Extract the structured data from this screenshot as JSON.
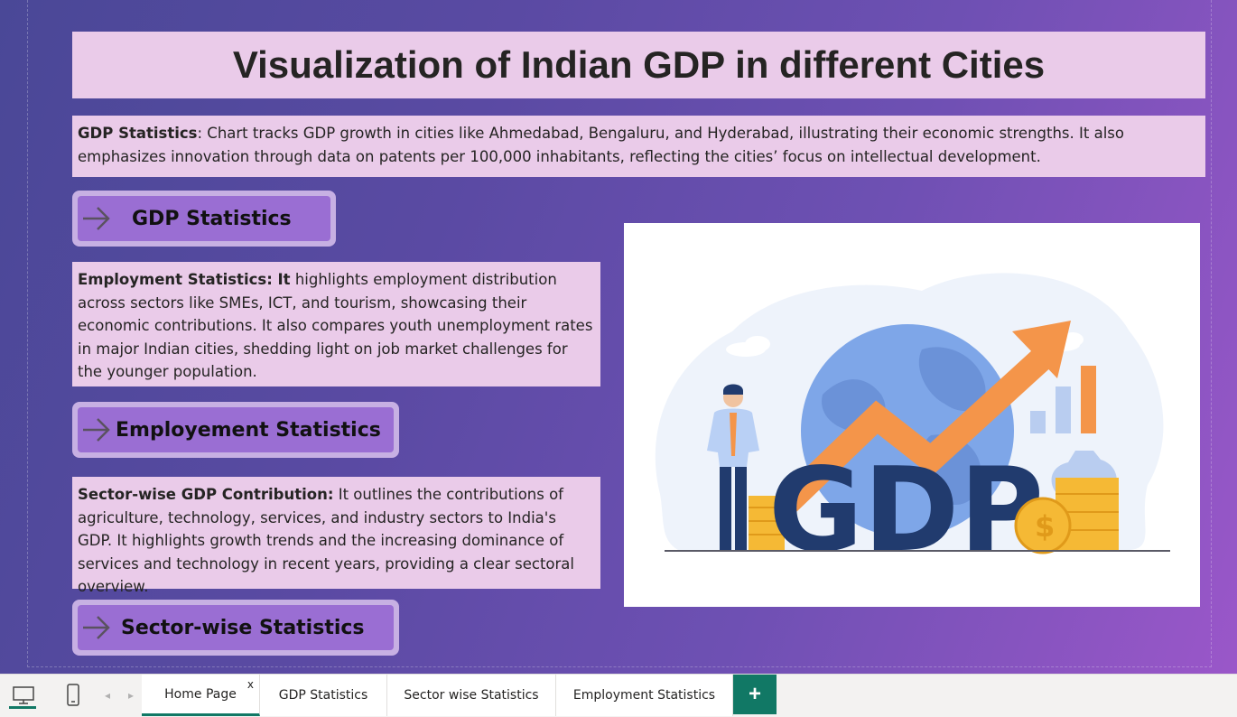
{
  "title": "Visualization of Indian GDP in different Cities",
  "gdp_text": {
    "heading": "GDP Statistics",
    "body": ": Chart tracks GDP growth in cities like Ahmedabad, Bengaluru, and Hyderabad, illustrating their economic strengths. It also emphasizes innovation through data on patents per 100,000 inhabitants, reflecting the cities’ focus on intellectual development."
  },
  "gdp_button": {
    "label": "GDP Statistics"
  },
  "employment_text": {
    "heading": "Employment Statistics: It",
    "body": " highlights employment distribution across sectors like SMEs, ICT, and tourism, showcasing their economic contributions. It also compares youth unemployment rates in major Indian cities, shedding light on job market challenges for the younger population."
  },
  "employment_button": {
    "label": "Employement Statistics"
  },
  "sector_text": {
    "heading": "Sector-wise GDP Contribution:",
    "body": "  It outlines the contributions of agriculture, technology, services, and industry sectors to India's GDP. It highlights growth trends and the increasing dominance of services and technology in recent years, providing a clear sectoral overview."
  },
  "sector_button": {
    "label": "Sector-wise Statistics"
  },
  "illustration": {
    "word": "GDP"
  },
  "tabbar": {
    "tabs": [
      {
        "label": "Home Page",
        "active": true,
        "close": "x"
      },
      {
        "label": "GDP Statistics"
      },
      {
        "label": "Sector wise Statistics"
      },
      {
        "label": "Employment Statistics"
      }
    ],
    "add_label": "+"
  },
  "colors": {
    "text_box_bg": "#eacbe9",
    "button_outer": "#c7b0e3",
    "button_inner": "#9a6ed3",
    "tab_accent": "#117865",
    "gdp_text_color": "#213b6e",
    "arrow_color": "#f4954a"
  },
  "icons": [
    "desktop-icon",
    "phone-icon",
    "chevron-left-icon",
    "chevron-right-icon",
    "arrow-right-icon",
    "plus-icon"
  ]
}
